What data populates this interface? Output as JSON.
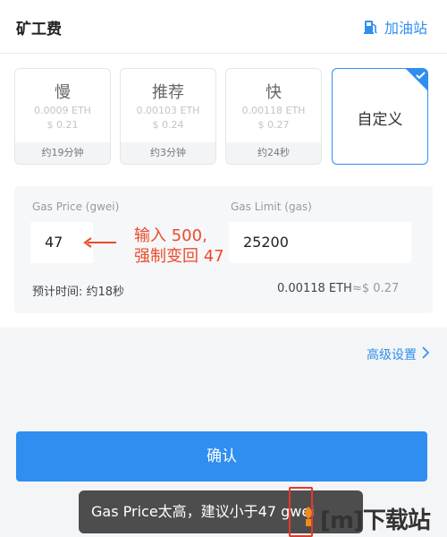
{
  "header": {
    "title": "矿工费",
    "station_label": "加油站"
  },
  "speeds": [
    {
      "name": "慢",
      "eth": "0.0009 ETH",
      "usd": "$ 0.21",
      "time": "约19分钟"
    },
    {
      "name": "推荐",
      "eth": "0.00103 ETH",
      "usd": "$ 0.24",
      "time": "约3分钟"
    },
    {
      "name": "快",
      "eth": "0.00118 ETH",
      "usd": "$ 0.27",
      "time": "约24秒"
    }
  ],
  "custom": {
    "label": "自定义",
    "selected": true
  },
  "gas": {
    "price_label": "Gas Price (gwei)",
    "price_value": "47",
    "limit_label": "Gas Limit (gas)",
    "limit_value": "25200",
    "estimate_label": "预计时间: 约18秒",
    "eth_value": "0.00118 ETH",
    "usd_value": "≈$ 0.27"
  },
  "annotation": {
    "line1": "输入 500,",
    "line2": "强制变回 47"
  },
  "advanced_label": "高级设置",
  "confirm_label": "确认",
  "toast": "Gas Price太高，建议小于47 gwei",
  "watermark": "[m]下载站",
  "colors": {
    "accent": "#2f8ef0",
    "annotation": "#ea4b2a",
    "toast_bg": "#4d4d4d"
  }
}
